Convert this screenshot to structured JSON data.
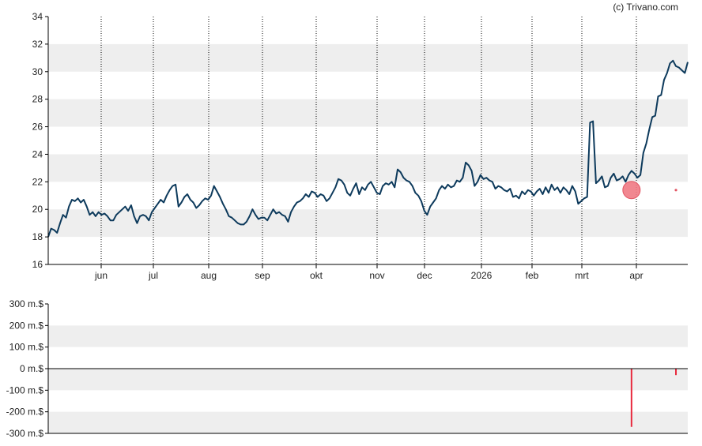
{
  "credit": "(c) Trivano.com",
  "colors": {
    "price_line": "#0d3a5c",
    "band": "#eeeeee",
    "axis": "#000000",
    "grid_dotted": "#000000",
    "marker_fill": "#f07a84",
    "marker_stroke": "#e25563",
    "volume_bar": "#e8293d"
  },
  "chart_data": [
    {
      "type": "line",
      "title": "",
      "xlabel": "",
      "ylabel": "",
      "ylim": [
        16,
        34
      ],
      "yticks": [
        "16",
        "18",
        "20",
        "22",
        "24",
        "26",
        "28",
        "30",
        "32",
        "34"
      ],
      "x_tick_labels": [
        "jun",
        "jul",
        "aug",
        "sep",
        "okt",
        "nov",
        "dec",
        "2026",
        "feb",
        "mrt",
        "apr"
      ],
      "grid": "alternating horizontal bands, dotted vertical lines at month ticks",
      "series": [
        {
          "values": [
            18.0,
            18.6,
            18.5,
            18.3,
            19.0,
            19.6,
            19.4,
            20.2,
            20.7,
            20.6,
            20.8,
            20.5,
            20.7,
            20.2,
            19.6,
            19.8,
            19.5,
            19.8,
            19.6,
            19.7,
            19.5,
            19.2,
            19.2,
            19.6,
            19.8,
            20.0,
            20.2,
            19.9,
            20.3,
            19.5,
            19.0,
            19.5,
            19.6,
            19.5,
            19.2,
            19.8,
            20.1,
            20.4,
            20.7,
            20.5,
            21.0,
            21.4,
            21.7,
            21.8,
            20.2,
            20.5,
            20.9,
            21.1,
            20.7,
            20.5,
            20.1,
            20.3,
            20.6,
            20.8,
            20.7,
            21.0,
            21.7,
            21.3,
            20.9,
            20.4,
            20.0,
            19.5,
            19.4,
            19.2,
            19.0,
            18.9,
            18.9,
            19.1,
            19.5,
            20.0,
            19.6,
            19.3,
            19.4,
            19.4,
            19.2,
            19.6,
            20.0,
            19.7,
            19.8,
            19.6,
            19.5,
            19.1,
            19.8,
            20.2,
            20.5,
            20.6,
            20.8,
            21.1,
            20.9,
            21.3,
            21.2,
            20.9,
            21.1,
            21.0,
            20.6,
            20.8,
            21.2,
            21.6,
            22.2,
            22.1,
            21.8,
            21.2,
            21.0,
            21.5,
            21.9,
            21.1,
            21.6,
            21.4,
            21.8,
            22.0,
            21.6,
            21.2,
            21.1,
            21.7,
            21.9,
            21.8,
            22.0,
            21.6,
            22.9,
            22.7,
            22.3,
            22.1,
            22.0,
            21.7,
            21.2,
            21.0,
            20.6,
            19.9,
            19.6,
            20.2,
            20.5,
            20.8,
            21.4,
            21.7,
            21.5,
            21.8,
            21.6,
            21.7,
            22.1,
            22.0,
            22.3,
            23.4,
            23.2,
            22.8,
            21.7,
            22.0,
            22.5,
            22.2,
            22.3,
            22.1,
            22.0,
            21.5,
            21.7,
            21.6,
            21.4,
            21.3,
            21.5,
            20.9,
            21.0,
            20.8,
            21.3,
            21.1,
            21.4,
            21.3,
            21.0,
            21.3,
            21.5,
            21.1,
            21.6,
            21.2,
            21.8,
            21.4,
            21.6,
            21.2,
            21.6,
            21.4,
            21.1,
            21.7,
            21.3,
            20.4,
            20.6,
            20.8,
            20.9,
            26.3,
            26.4,
            21.9,
            22.1,
            22.4,
            21.6,
            21.7,
            22.3,
            22.6,
            22.1,
            22.2,
            22.4,
            22.0,
            22.5,
            22.8,
            22.6,
            22.3,
            22.5,
            24.1,
            24.8,
            25.8,
            26.7,
            26.8,
            28.2,
            28.3,
            29.4,
            29.9,
            30.6,
            30.8,
            30.4,
            30.3,
            30.1,
            29.9,
            30.7
          ]
        }
      ],
      "markers": [
        {
          "type": "insider-sell",
          "x_index": 197,
          "y": 21.4
        },
        {
          "type": "insider-sell-small",
          "x_index": 212,
          "y": 21.4
        }
      ]
    },
    {
      "type": "bar",
      "title": "",
      "ylim": [
        -300,
        300
      ],
      "yticks": [
        "300 m.$",
        "200 m.$",
        "100 m.$",
        "0 m.$",
        "-100 m.$",
        "-200 m.$",
        "-300 m.$"
      ],
      "bars": [
        {
          "x_index": 197,
          "value": -270
        },
        {
          "x_index": 212,
          "value": -30
        }
      ]
    }
  ]
}
